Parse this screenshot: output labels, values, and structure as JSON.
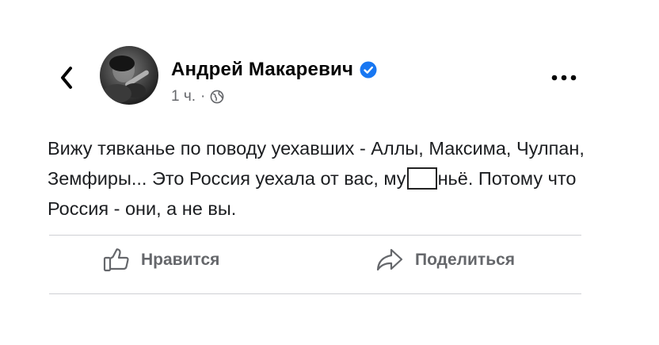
{
  "post": {
    "author_name": "Андрей Макаревич",
    "time_ago": "1 ч.",
    "meta_separator": "·",
    "audience_icon": "globe-icon",
    "verified_icon": "verified-badge-icon",
    "text": {
      "part1": "Вижу тявканье по поводу уехавших - Аллы, Максима, Чулпан, Земфиры... Это Россия уехала от вас, му",
      "part2": "ньё. Потому что Россия - они, а не вы."
    }
  },
  "actions": {
    "like_label": "Нравится",
    "share_label": "Поделиться"
  },
  "colors": {
    "verified_blue": "#1877f2",
    "secondary_text": "#65676b",
    "divider": "#ced0d4"
  }
}
